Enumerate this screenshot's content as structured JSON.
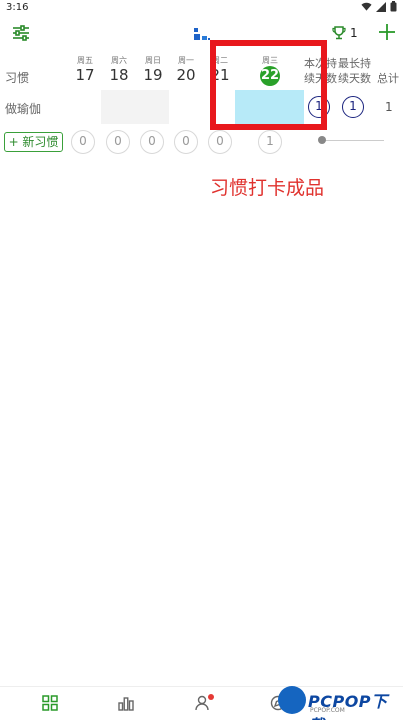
{
  "status_bar": {
    "time": "3:16"
  },
  "app_bar": {
    "trophy_count": "1"
  },
  "days": [
    {
      "weekday": "周五",
      "date": "17"
    },
    {
      "weekday": "周六",
      "date": "18"
    },
    {
      "weekday": "周日",
      "date": "19"
    },
    {
      "weekday": "周一",
      "date": "20"
    },
    {
      "weekday": "周二",
      "date": "21"
    },
    {
      "weekday": "周三",
      "date": "22",
      "today": true
    }
  ],
  "columns": {
    "habit_label": "习惯",
    "current_streak_line1": "本次持",
    "current_streak_line2": "续天数",
    "best_streak_line1": "最长持",
    "best_streak_line2": "续天数",
    "total": "总计"
  },
  "habits": [
    {
      "name": "做瑜伽",
      "current_streak": "1",
      "best_streak": "1",
      "total": "1"
    }
  ],
  "new_habit_button": "+ 新习惯",
  "empty_day_counts": [
    "0",
    "0",
    "0",
    "0",
    "0",
    "1"
  ],
  "annotation": "习惯打卡成品",
  "watermark": {
    "brand": "PCPOP下载",
    "sub": "PCPOP.COM"
  },
  "colors": {
    "accent_green": "#2aa12a",
    "today_cell": "#b7eaf8",
    "annotation_red": "#e8181d",
    "streak_ring": "#1a237e"
  }
}
